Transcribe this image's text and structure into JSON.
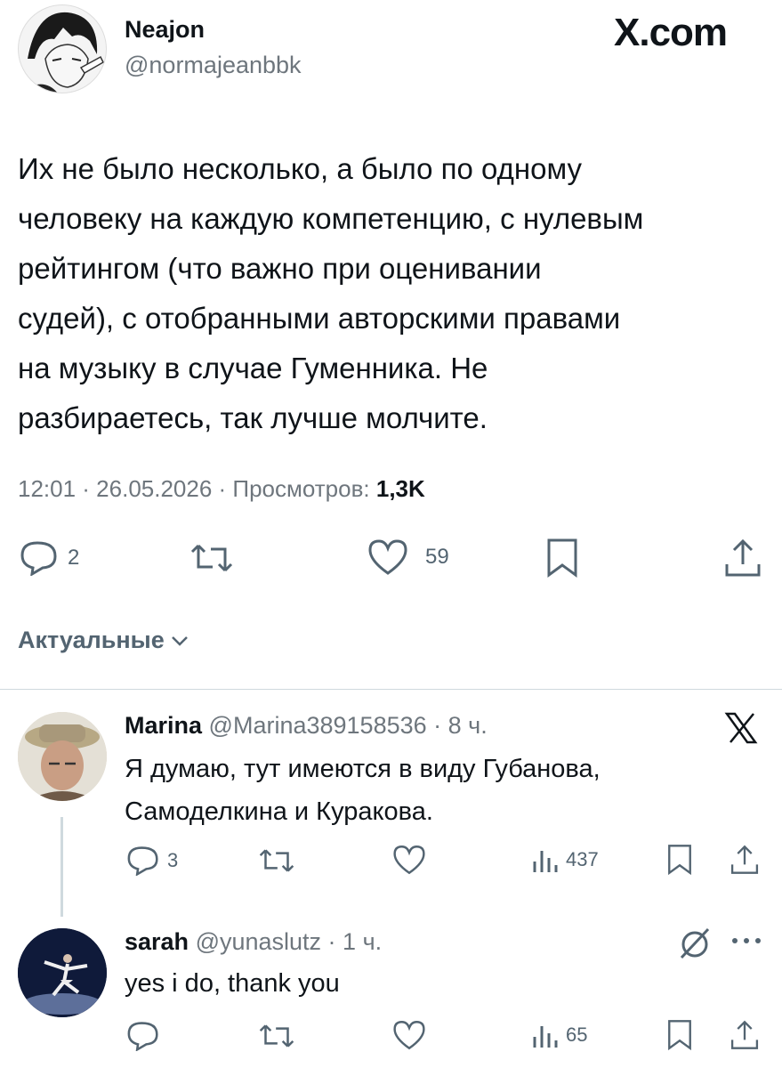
{
  "brand": {
    "logo_text": "X.com"
  },
  "tweet": {
    "author_name": "Neajon",
    "author_handle": "@normajeanbbk",
    "lines": [
      "Их не было несколько, а было по одному",
      "человеку на каждую компетенцию, с нулевым",
      "рейтингом (что важно при оценивании",
      "судей), с отобранными авторскими правами",
      "на музыку в случае Гуменника. Не",
      "разбираетесь, так лучше молчите."
    ],
    "meta_prefix": "12:01 · 26.05.2026 · Просмотров:",
    "meta_views": "1,3K",
    "reply_count": "2",
    "like_count": "59"
  },
  "sort": {
    "label": "Актуальные"
  },
  "replies": [
    {
      "name": "Marina",
      "handle_time": "@Marina389158536 · 8 ч.",
      "lines": [
        "Я думаю, тут имеются в виду Губанова,",
        "Самоделкина и Куракова."
      ],
      "reply_count": "3",
      "views": "437"
    },
    {
      "name": "sarah",
      "handle_time": "@yunaslutz · 1 ч.",
      "lines": [
        "yes i do, thank you"
      ],
      "views": "65"
    }
  ]
}
